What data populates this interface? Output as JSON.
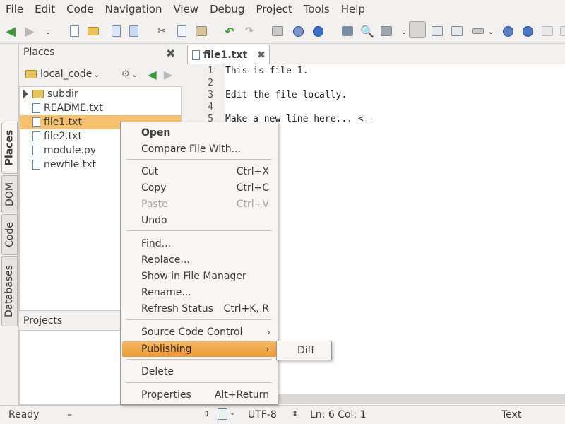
{
  "menubar": {
    "items": [
      "File",
      "Edit",
      "Code",
      "Navigation",
      "View",
      "Debug",
      "Project",
      "Tools",
      "Help"
    ]
  },
  "places": {
    "title": "Places",
    "location": "local_code"
  },
  "tree": {
    "items": [
      {
        "name": "subdir",
        "kind": "folder"
      },
      {
        "name": "README.txt",
        "kind": "file"
      },
      {
        "name": "file1.txt",
        "kind": "file",
        "selected": true
      },
      {
        "name": "file2.txt",
        "kind": "file"
      },
      {
        "name": "module.py",
        "kind": "file"
      },
      {
        "name": "newfile.txt",
        "kind": "file"
      }
    ]
  },
  "projects": {
    "title": "Projects"
  },
  "side_tabs": [
    "Places",
    "DOM",
    "Code",
    "Databases"
  ],
  "editor": {
    "tab_title": "file1.txt",
    "line_numbers": [
      "1",
      "2",
      "3",
      "4",
      "5"
    ],
    "lines": [
      "This is file 1.",
      "",
      "Edit the file locally.",
      "",
      "Make a new line here... <--"
    ]
  },
  "context_menu": {
    "items": [
      {
        "label": "Open",
        "shortcut": "",
        "bold": true
      },
      {
        "label": "Compare File With...",
        "shortcut": ""
      },
      {
        "label": "Cut",
        "shortcut": "Ctrl+X"
      },
      {
        "label": "Copy",
        "shortcut": "Ctrl+C"
      },
      {
        "label": "Paste",
        "shortcut": "Ctrl+V",
        "disabled": true
      },
      {
        "label": "Undo",
        "shortcut": ""
      },
      {
        "label": "Find...",
        "shortcut": ""
      },
      {
        "label": "Replace...",
        "shortcut": ""
      },
      {
        "label": "Show in File Manager",
        "shortcut": ""
      },
      {
        "label": "Rename...",
        "shortcut": ""
      },
      {
        "label": "Refresh Status",
        "shortcut": "Ctrl+K, R"
      },
      {
        "label": "Source Code Control",
        "shortcut": "",
        "submenu": true
      },
      {
        "label": "Publishing",
        "shortcut": "",
        "submenu": true,
        "highlighted": true
      },
      {
        "label": "Delete",
        "shortcut": ""
      },
      {
        "label": "Properties",
        "shortcut": "Alt+Return"
      }
    ],
    "submenu_label": "Diff"
  },
  "statusbar": {
    "status": "Ready",
    "dash": "–",
    "encoding": "UTF-8",
    "position": "Ln: 6 Col: 1",
    "language": "Text"
  },
  "colors": {
    "selection": "#f6c16e",
    "highlight": "#ef9a36",
    "toolbar_green": "#3a9a3a"
  }
}
